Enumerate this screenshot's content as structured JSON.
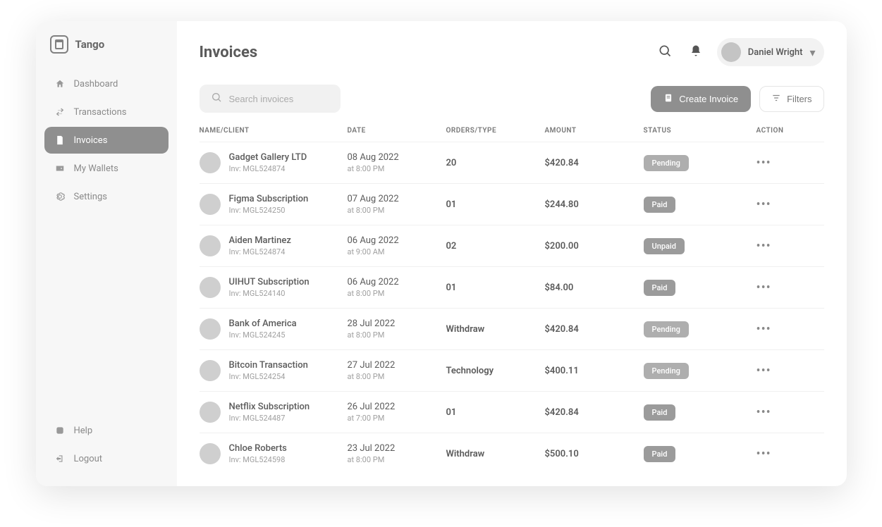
{
  "brand": {
    "name": "Tango"
  },
  "user": {
    "name": "Daniel Wright"
  },
  "sidebar": {
    "nav": [
      {
        "label": "Dashboard"
      },
      {
        "label": "Transactions"
      },
      {
        "label": "Invoices"
      },
      {
        "label": "My Wallets"
      },
      {
        "label": "Settings"
      }
    ],
    "bottom": [
      {
        "label": "Help"
      },
      {
        "label": "Logout"
      }
    ]
  },
  "page": {
    "title": "Invoices"
  },
  "search": {
    "placeholder": "Search invoices"
  },
  "actions": {
    "create": "Create Invoice",
    "filters": "Filters"
  },
  "table": {
    "headers": {
      "name": "NAME/CLIENT",
      "date": "DATE",
      "orders": "ORDERS/TYPE",
      "amount": "AMOUNT",
      "status": "STATUS",
      "action": "ACTION"
    },
    "rows": [
      {
        "name": "Gadget Gallery LTD",
        "sub": "Inv: MGL524874",
        "date": "08 Aug 2022",
        "time": "at 8:00 PM",
        "orders": "20",
        "amount": "$420.84",
        "status": "Pending"
      },
      {
        "name": "Figma Subscription",
        "sub": "Inv: MGL524250",
        "date": "07 Aug 2022",
        "time": "at 8:00 PM",
        "orders": "01",
        "amount": "$244.80",
        "status": "Paid"
      },
      {
        "name": "Aiden Martinez",
        "sub": "Inv: MGL524874",
        "date": "06 Aug 2022",
        "time": "at 9:00 AM",
        "orders": "02",
        "amount": "$200.00",
        "status": "Unpaid"
      },
      {
        "name": "UIHUT Subscription",
        "sub": "Inv: MGL524140",
        "date": "06 Aug 2022",
        "time": "at 8:00 PM",
        "orders": "01",
        "amount": "$84.00",
        "status": "Paid"
      },
      {
        "name": "Bank of America",
        "sub": "Inv: MGL524245",
        "date": "28 Jul 2022",
        "time": "at 8:00 PM",
        "orders": "Withdraw",
        "amount": "$420.84",
        "status": "Pending"
      },
      {
        "name": "Bitcoin Transaction",
        "sub": "Inv: MGL524254",
        "date": "27 Jul 2022",
        "time": "at 8:00 PM",
        "orders": "Technology",
        "amount": "$400.11",
        "status": "Pending"
      },
      {
        "name": "Netflix Subscription",
        "sub": "Inv: MGL524487",
        "date": "26 Jul 2022",
        "time": "at 7:00 PM",
        "orders": "01",
        "amount": "$420.84",
        "status": "Paid"
      },
      {
        "name": "Chloe Roberts",
        "sub": "Inv: MGL524598",
        "date": "23 Jul 2022",
        "time": "at 8:00 PM",
        "orders": "Withdraw",
        "amount": "$500.10",
        "status": "Paid"
      }
    ]
  }
}
